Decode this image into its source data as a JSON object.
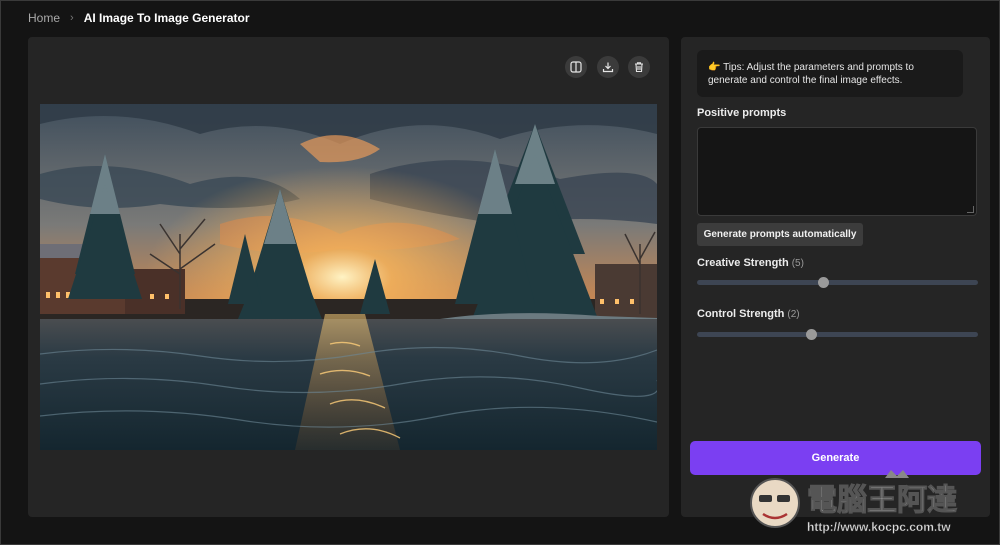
{
  "breadcrumb": {
    "home": "Home",
    "separator": "›",
    "current": "AI Image To Image Generator"
  },
  "toolbar": {
    "compare_icon": "split-view-icon",
    "download_icon": "download-icon",
    "delete_icon": "trash-icon"
  },
  "tips": {
    "icon": "👉",
    "text": "Tips: Adjust the parameters and prompts to generate and control the final image effects."
  },
  "positive_prompts": {
    "label": "Positive prompts",
    "value": "",
    "auto_button": "Generate prompts automatically"
  },
  "creative_strength": {
    "label": "Creative Strength",
    "value_text": "(5)",
    "value": 5,
    "fraction": 0.45
  },
  "control_strength": {
    "label": "Control Strength",
    "value_text": "(2)",
    "value": 2,
    "fraction": 0.405
  },
  "generate_button": "Generate",
  "watermark": {
    "title": "電腦王阿達",
    "url": "http://www.kocpc.com.tw"
  },
  "colors": {
    "accent": "#7b3ff2",
    "panel": "#252525",
    "background": "#141414"
  }
}
